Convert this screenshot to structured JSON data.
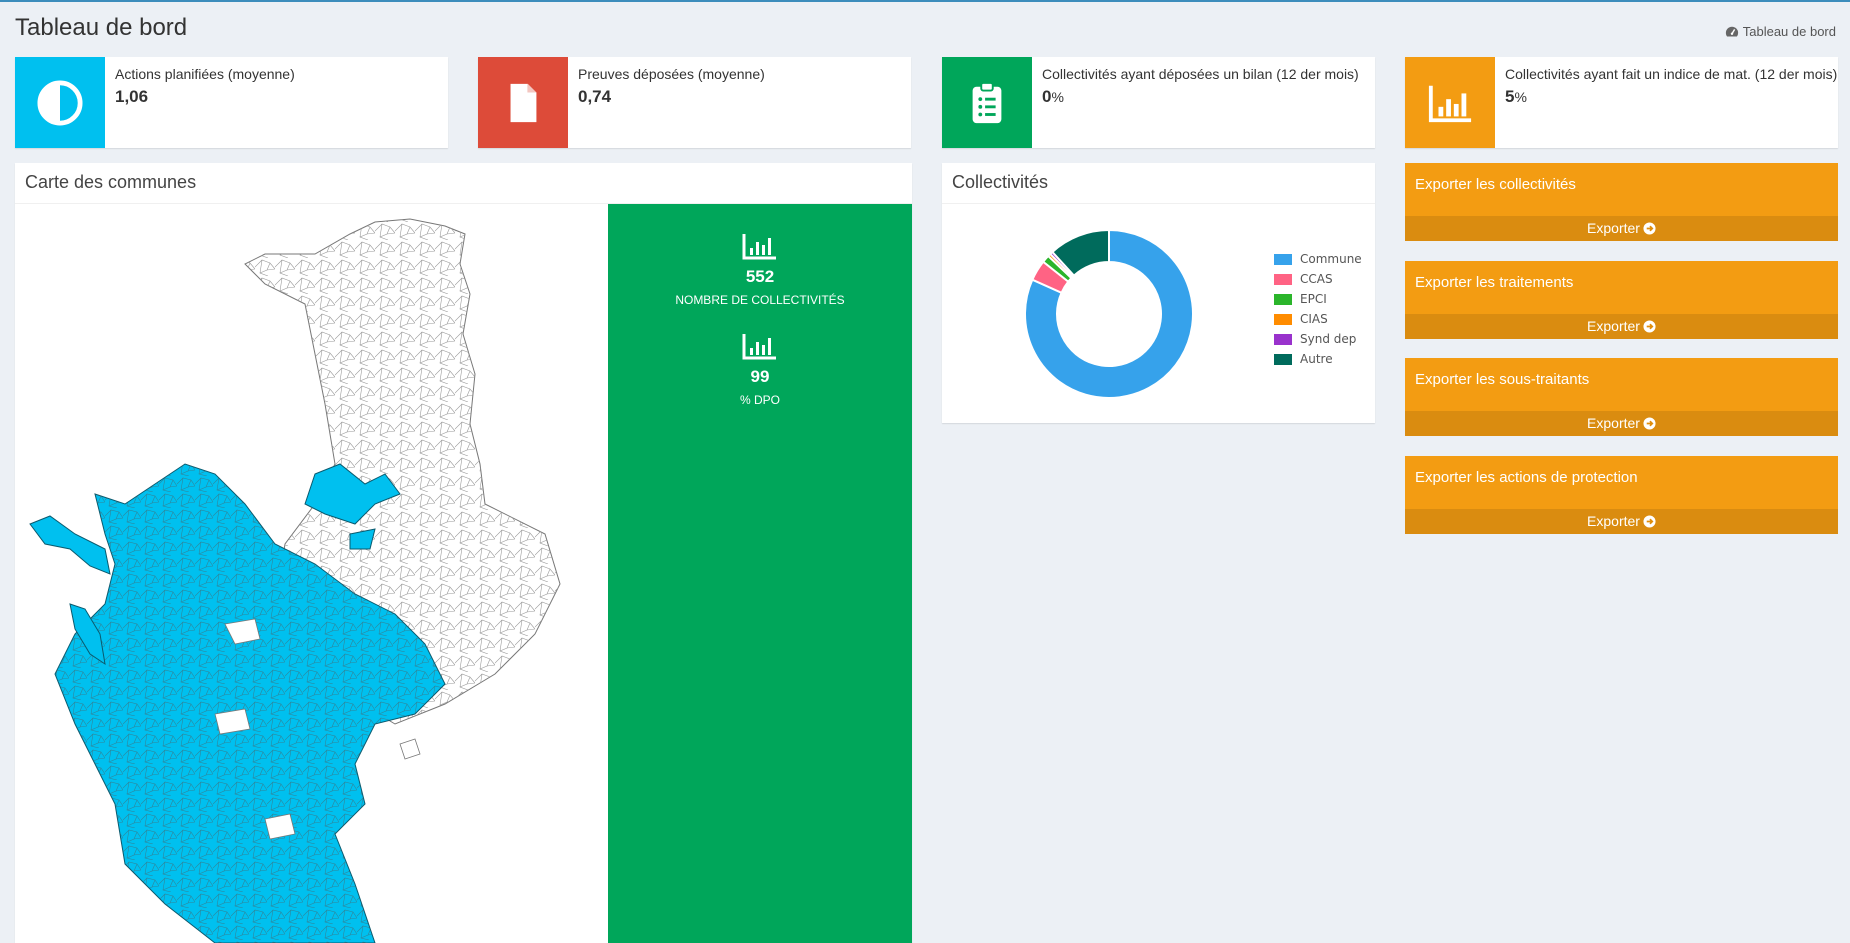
{
  "header": {
    "title": "Tableau de bord",
    "breadcrumb": "Tableau de bord",
    "breadcrumb_icon": "dashboard-icon"
  },
  "info_boxes": [
    {
      "label": "Actions planifiées (moyenne)",
      "value": "1,06",
      "unit": "",
      "color": "#00c0ef",
      "icon": "pie-icon"
    },
    {
      "label": "Preuves déposées (moyenne)",
      "value": "0,74",
      "unit": "",
      "color": "#dd4b39",
      "icon": "file-icon"
    },
    {
      "label": "Collectivités ayant déposées un bilan (12 der mois)",
      "value": "0",
      "unit": "%",
      "color": "#00a65a",
      "icon": "clipboard-list-icon"
    },
    {
      "label": "Collectivités ayant fait un indice de mat. (12 der mois)",
      "value": "5",
      "unit": "%",
      "color": "#f39c12",
      "icon": "bar-chart-icon"
    }
  ],
  "map_panel": {
    "title": "Carte des communes",
    "highlight_color": "#00c0ef",
    "stats": [
      {
        "value": "552",
        "label": "NOMBRE DE COLLECTIVITÉS",
        "icon": "bar-chart-icon"
      },
      {
        "value": "99",
        "label": "% DPO",
        "icon": "bar-chart-icon"
      }
    ]
  },
  "chart_panel": {
    "title": "Collectivités"
  },
  "chart_data": {
    "type": "pie",
    "variant": "doughnut",
    "categories": [
      "Commune",
      "CCAS",
      "EPCI",
      "CIAS",
      "Synd dep",
      "Autre"
    ],
    "values": [
      451,
      22,
      8,
      3,
      3,
      65
    ],
    "colors": [
      "#36a2eb",
      "#ff6384",
      "#2bb52b",
      "#ff8c00",
      "#9932cc",
      "#006b5c"
    ],
    "legend": "right"
  },
  "exports": [
    {
      "title": "Exporter les collectivités",
      "button": "Exporter"
    },
    {
      "title": "Exporter les traitements",
      "button": "Exporter"
    },
    {
      "title": "Exporter les sous-traitants",
      "button": "Exporter"
    },
    {
      "title": "Exporter les actions de protection",
      "button": "Exporter"
    }
  ]
}
